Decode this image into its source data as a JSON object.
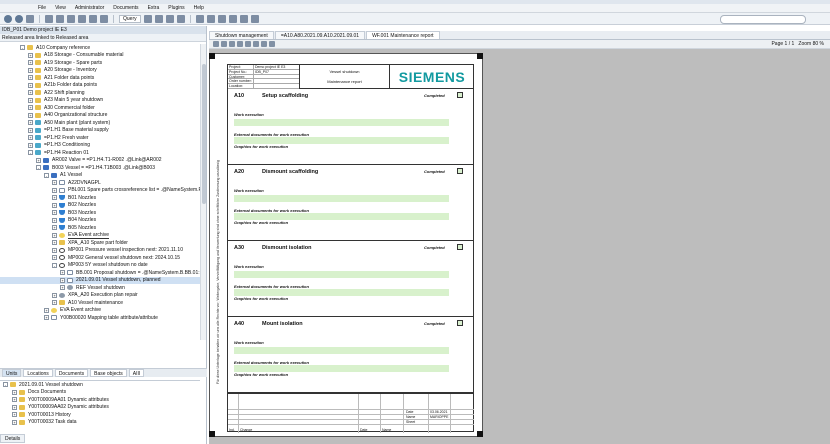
{
  "window": {
    "title": "IDB_P01 : Demo project IE E3",
    "menu": [
      "File",
      "View",
      "Administrator",
      "Documents",
      "Extra",
      "Plugins",
      "Help"
    ],
    "query_label": "Query"
  },
  "left": {
    "header": "IDB_P01 Demo project IE E3",
    "subheader": "Released area linked to Released area",
    "tree": [
      {
        "label": "A10  Company reference",
        "icon": "folder",
        "indent": 0,
        "exp": "-"
      },
      {
        "label": "A18  Storage - Consumable material",
        "icon": "folder",
        "indent": 1,
        "exp": "+"
      },
      {
        "label": "A19  Storage - Spare parts",
        "icon": "folder",
        "indent": 1,
        "exp": "+"
      },
      {
        "label": "A20  Storage - Inventory",
        "icon": "folder",
        "indent": 1,
        "exp": "+"
      },
      {
        "label": "A21  Folder data points",
        "icon": "folder",
        "indent": 1,
        "exp": "+"
      },
      {
        "label": "A21b  Folder data points",
        "icon": "folder",
        "indent": 1,
        "exp": "+"
      },
      {
        "label": "A22  Shift planning",
        "icon": "folder",
        "indent": 1,
        "exp": "+"
      },
      {
        "label": "A23  Main 5 year shutdown",
        "icon": "folder",
        "indent": 1,
        "exp": "+"
      },
      {
        "label": "A30  Commercial folder",
        "icon": "folder",
        "indent": 1,
        "exp": "+"
      },
      {
        "label": "A40  Organizational structure",
        "icon": "folder",
        "indent": 1,
        "exp": "+"
      },
      {
        "label": "A50  Main plant (plant system)",
        "icon": "plant",
        "indent": 1,
        "exp": "+"
      },
      {
        "label": "=P1.H1  Base material supply",
        "icon": "plant",
        "indent": 1,
        "exp": "+"
      },
      {
        "label": "=P1.H2  Fresh water",
        "icon": "plant",
        "indent": 1,
        "exp": "+"
      },
      {
        "label": "=P1.H3  Conditioning",
        "icon": "plant",
        "indent": 1,
        "exp": "+"
      },
      {
        "label": "=P1.H4  Reaction 01",
        "icon": "plant",
        "indent": 1,
        "exp": "-"
      },
      {
        "label": "AR002  Valve  =  =P1.H4.T1-R002 .@Link@AR002",
        "icon": "valve",
        "indent": 2,
        "exp": "+"
      },
      {
        "label": "B003  Vessel  =  =P1.H4.T1B003 .@Link@B003",
        "icon": "valve",
        "indent": 2,
        "exp": "-"
      },
      {
        "label": "A1  Vessel",
        "icon": "valve",
        "indent": 3,
        "exp": "-"
      },
      {
        "label": "A22DVNAGPL",
        "icon": "doc",
        "indent": 4,
        "exp": "+"
      },
      {
        "label": "PBL001  Spare parts crossreference list  =  .@NameSystem.P",
        "icon": "doc",
        "indent": 4,
        "exp": "+"
      },
      {
        "label": "B01  Nozzles",
        "icon": "nozzle",
        "indent": 4,
        "exp": "+"
      },
      {
        "label": "B02  Nozzles",
        "icon": "nozzle",
        "indent": 4,
        "exp": "+"
      },
      {
        "label": "B03  Nozzles",
        "icon": "nozzle",
        "indent": 4,
        "exp": "+"
      },
      {
        "label": "B04  Nozzles",
        "icon": "nozzle",
        "indent": 4,
        "exp": "+"
      },
      {
        "label": "B05  Nozzles",
        "icon": "nozzle",
        "indent": 4,
        "exp": "+"
      },
      {
        "label": "EVA  Event archive",
        "icon": "bulb",
        "indent": 4,
        "exp": "+",
        "hl": true
      },
      {
        "label": "XPA_A10  Spare part folder",
        "icon": "folder",
        "indent": 4,
        "exp": "+"
      },
      {
        "label": "MP001  Pressure vessel inspection   next: 2021.11.10",
        "icon": "circle",
        "indent": 4,
        "exp": "+"
      },
      {
        "label": "MP002  General vessel shutdown   next: 2024.10.15",
        "icon": "circle",
        "indent": 4,
        "exp": "+"
      },
      {
        "label": "MP003  5Y vessel shutdown  no date",
        "icon": "circle",
        "indent": 4,
        "exp": "-"
      },
      {
        "label": "BB.001  Proposal shutdown  =  .@NameSystem.B.BB.01:",
        "icon": "doc",
        "indent": 5,
        "exp": "+"
      },
      {
        "label": "2021.09.01  Vessel shutdown, planned",
        "icon": "doc",
        "indent": 5,
        "exp": "+",
        "sel": true
      },
      {
        "label": "REF  Vessel shutdown",
        "icon": "gear",
        "indent": 5,
        "exp": "+"
      },
      {
        "label": "XPA_A20  Execution plan repair",
        "icon": "gear",
        "indent": 4,
        "exp": "+"
      },
      {
        "label": "A10  Vessel maintenance",
        "icon": "folder",
        "indent": 4,
        "exp": "+"
      },
      {
        "label": "EVA  Event archive",
        "icon": "bulb",
        "indent": 3,
        "exp": "+"
      },
      {
        "label": "Y00B00020  Mapping table attribute/attribute",
        "icon": "doc",
        "indent": 3,
        "exp": "+"
      }
    ],
    "bottom_tabs": [
      "Units",
      "Locations",
      "Documents",
      "Base objects",
      "AIII"
    ],
    "subtree": [
      {
        "label": "2021.09.01  Vessel shutdown",
        "exp": "-"
      },
      {
        "label": "Docs  Documents",
        "exp": "+"
      },
      {
        "label": "Y00T00009AA01  Dynamic attributes",
        "exp": "+"
      },
      {
        "label": "Y00T00009AA02  Dynamic attributes",
        "exp": "+"
      },
      {
        "label": "Y00T00013  History",
        "exp": "+"
      },
      {
        "label": "Y00T00032  Task data",
        "exp": "+"
      }
    ],
    "details_tab": "Details"
  },
  "right": {
    "doc_tabs": [
      "Shutdown management",
      "=A10.A80.2021.09.A10.2021.09.01",
      "WF.001  Maintenance report"
    ],
    "page_info": "Page  1 / 1",
    "zoom_info": "Zoom  80 %"
  },
  "paper": {
    "header_rows": [
      [
        "Project:",
        "Demo project IE E3"
      ],
      [
        "Project No.:",
        "IDB_P07"
      ],
      [
        "Customer:",
        ""
      ],
      [
        "Order number:",
        ""
      ],
      [
        "Location:",
        ""
      ]
    ],
    "header_title": "Vessel shutdown",
    "header_subtitle": "Maintenance report",
    "logo": "SIEMENS",
    "completed_label": "Completed",
    "work_execution_label": "Work execution",
    "external_docs_label": "External documents for work execution",
    "graphics_label": "Graphics for work execution",
    "sections": [
      {
        "id": "A10",
        "title": "Setup scaffolding"
      },
      {
        "id": "A20",
        "title": "Dismount scaffolding"
      },
      {
        "id": "A30",
        "title": "Dismount isolation"
      },
      {
        "id": "A40",
        "title": "Mount isolation"
      }
    ],
    "side_text": "Für diese Unterlage behalten wir uns alle Rechte vor; Weitergabe, Vervielfältigung und Verwertung sind ohne schriftliche Zustimmung unzulässig",
    "titleblock": {
      "date_label": "Date",
      "name_label": "Name",
      "sheet_label": "Sheet",
      "date_value": "03.06.2021",
      "name_value": "MARIOPPE",
      "change_label": "Change",
      "index_label": "Ind.",
      "rev_label": "Date"
    }
  },
  "colors": {
    "siemens_teal": "#129aa0",
    "green_field": "#d8f1cc",
    "selection": "#cfe0f3",
    "viewer_bg": "#bdbdbd"
  }
}
